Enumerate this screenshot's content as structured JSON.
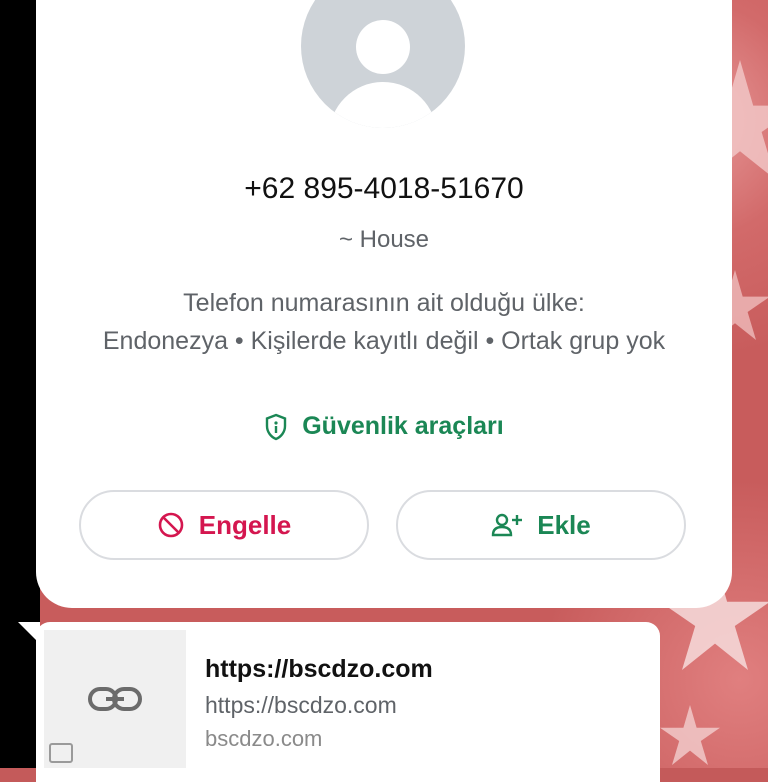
{
  "contact": {
    "phone": "+62 895-4018-51670",
    "pushname": "~ House",
    "info_line1": "Telefon numarasının ait olduğu ülke:",
    "info_line2": "Endonezya • Kişilerde kayıtlı değil • Ortak grup yok",
    "safety_tools": "Güvenlik araçları"
  },
  "actions": {
    "block_label": "Engelle",
    "add_label": "Ekle"
  },
  "link_preview": {
    "title": "https://bscdzo.com",
    "description": "https://bscdzo.com",
    "domain": "bscdzo.com"
  },
  "colors": {
    "green": "#1b8755",
    "red": "#d4164f",
    "wallpaper": "#c85c5c"
  },
  "icons": [
    "shield-icon",
    "block-icon",
    "add-person-icon",
    "link-icon"
  ]
}
